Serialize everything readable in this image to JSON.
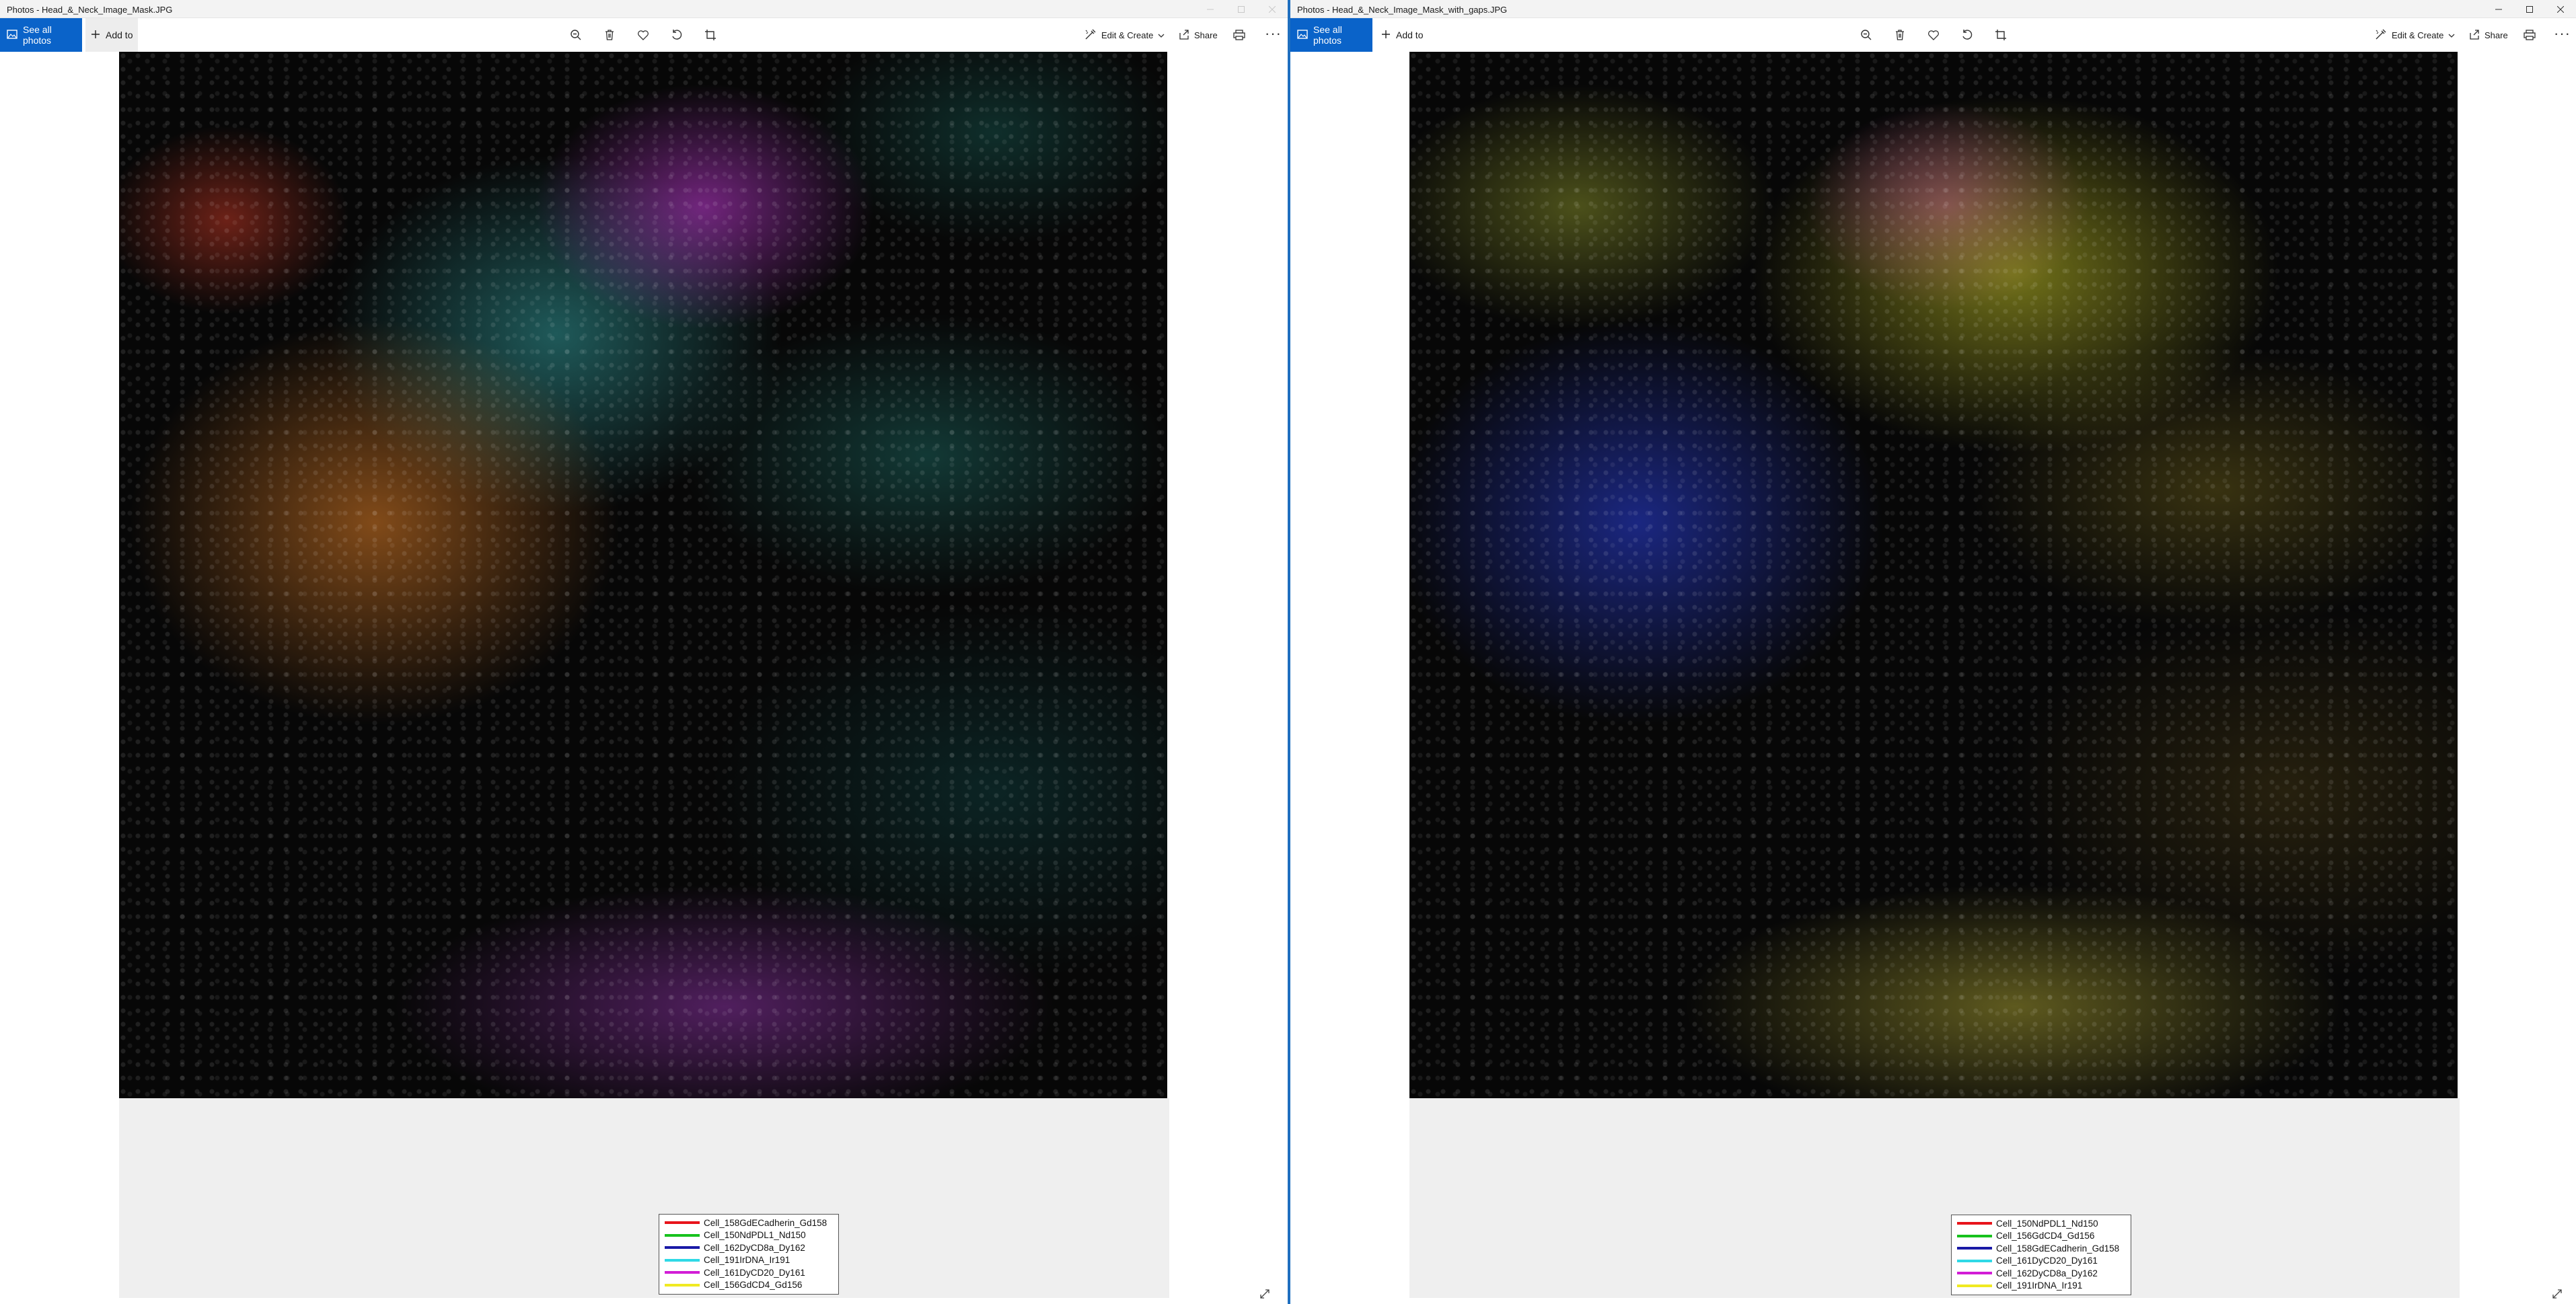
{
  "left": {
    "title": "Photos - Head_&_Neck_Image_Mask.JPG",
    "see_all_label": "See all photos",
    "add_to_label": "Add to",
    "edit_create_label": "Edit & Create",
    "share_label": "Share",
    "more_label": "···",
    "legend": [
      {
        "label": "Cell_158GdECadherin_Gd158",
        "color": "#e8141b"
      },
      {
        "label": "Cell_150NdPDL1_Nd150",
        "color": "#18c21e"
      },
      {
        "label": "Cell_162DyCD8a_Dy162",
        "color": "#1a1aa6"
      },
      {
        "label": "Cell_191IrDNA_Ir191",
        "color": "#2fd9e6"
      },
      {
        "label": "Cell_161DyCD20_Dy161",
        "color": "#d21ed6"
      },
      {
        "label": "Cell_156GdCD4_Gd156",
        "color": "#f0ea22"
      }
    ]
  },
  "right": {
    "title": "Photos - Head_&_Neck_Image_Mask_with_gaps.JPG",
    "see_all_label": "See all photos",
    "add_to_label": "Add to",
    "edit_create_label": "Edit & Create",
    "share_label": "Share",
    "more_label": "···",
    "legend": [
      {
        "label": "Cell_150NdPDL1_Nd150",
        "color": "#e8141b"
      },
      {
        "label": "Cell_156GdCD4_Gd156",
        "color": "#18c21e"
      },
      {
        "label": "Cell_158GdECadherin_Gd158",
        "color": "#1a1aa6"
      },
      {
        "label": "Cell_161DyCD20_Dy161",
        "color": "#2fd9e6"
      },
      {
        "label": "Cell_162DyCD8a_Dy162",
        "color": "#d21ed6"
      },
      {
        "label": "Cell_191IrDNA_Ir191",
        "color": "#f0ea22"
      }
    ]
  },
  "colors": {
    "accent": "#0a63c9",
    "divider": "#1f6fbf"
  },
  "icons": [
    "image-icon",
    "plus-icon",
    "zoom-icon",
    "delete-icon",
    "heart-icon",
    "rotate-icon",
    "crop-icon",
    "edit-icon",
    "share-icon",
    "print-icon",
    "more-icon",
    "expand-icon",
    "minimize-icon",
    "maximize-icon",
    "close-icon"
  ]
}
